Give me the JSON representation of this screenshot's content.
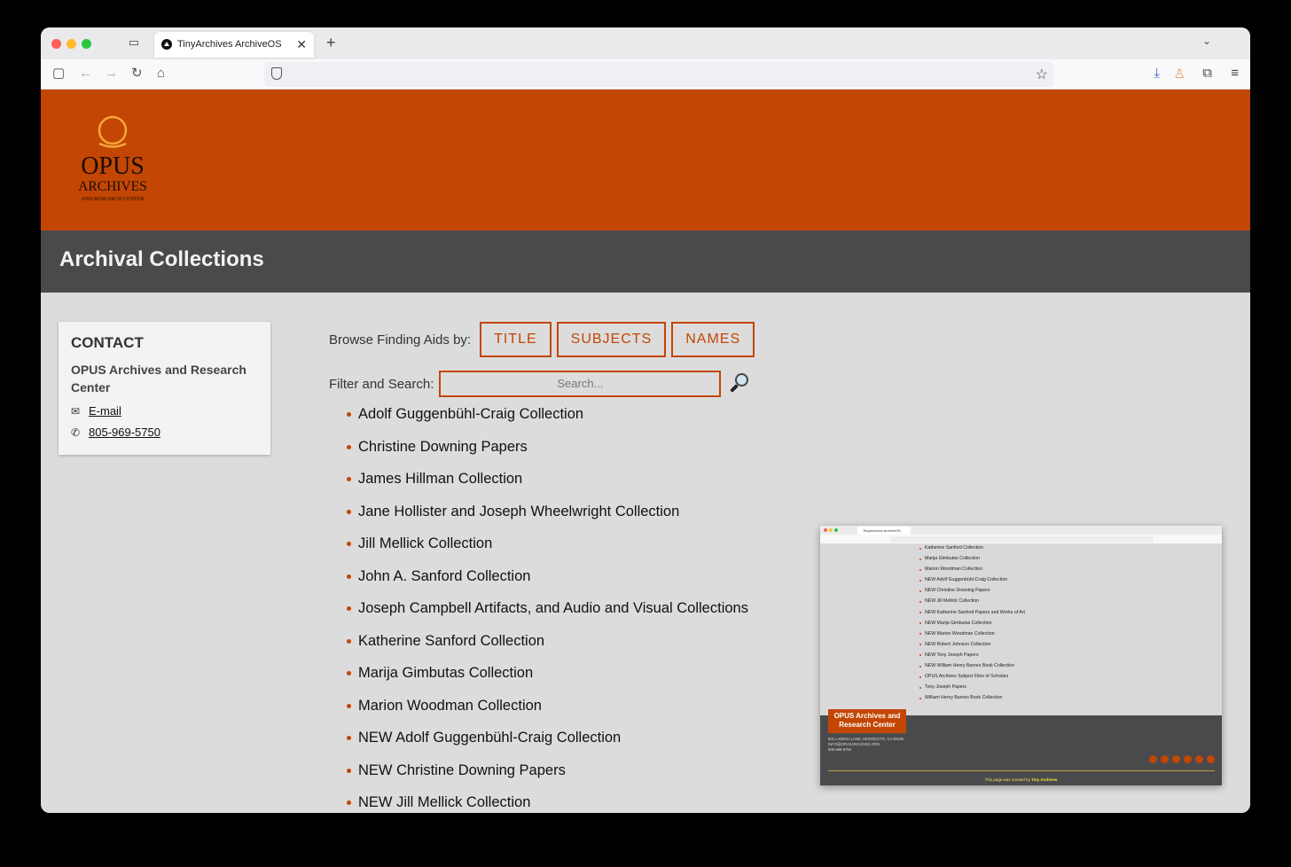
{
  "browser": {
    "tab_title": "TinyArchives ArchiveOS",
    "tab_close": "✕",
    "new_tab": "+",
    "tab_list": "⌄",
    "url": ""
  },
  "site": {
    "logo": {
      "line1": "OPUS",
      "line2": "ARCHIVES",
      "line3": "AND RESEARCH CENTER"
    },
    "page_title": "Archival Collections"
  },
  "contact": {
    "heading": "CONTACT",
    "org": "OPUS Archives and Research Center",
    "email_label": "E-mail",
    "phone": "805-969-5750"
  },
  "browse": {
    "label": "Browse Finding Aids by:",
    "buttons": [
      "TITLE",
      "SUBJECTS",
      "NAMES"
    ]
  },
  "filter": {
    "label": "Filter and Search:",
    "placeholder": "Search..."
  },
  "collections": [
    "Adolf Guggenbühl-Craig Collection",
    "Christine Downing Papers",
    "James Hillman Collection",
    "Jane Hollister and Joseph Wheelwright Collection",
    "Jill Mellick Collection",
    "John A. Sanford Collection",
    "Joseph Campbell Artifacts, and Audio and Visual Collections",
    "Katherine Sanford Collection",
    "Marija Gimbutas Collection",
    "Marion Woodman Collection",
    "NEW Adolf Guggenbühl-Craig Collection",
    "NEW Christine Downing Papers",
    "NEW Jill Mellick Collection"
  ],
  "inset": {
    "tab_title": "TinyArchives ArchiveOS",
    "list": [
      "Katherine Sanford Collection",
      "Marija Gimbutas Collection",
      "Marion Woodman Collection",
      "NEW Adolf Guggenbühl-Craig Collection",
      "NEW Christine Downing Papers",
      "NEW Jill Mellick Collection",
      "NEW Katherine Sanford Papers and Works of Art",
      "NEW Marija Gimbutas Collection",
      "NEW Marion Woodman Collection",
      "NEW Robert Johnson Collection",
      "NEW Tony Joseph Papers",
      "NEW William Henry Barnes Book Collection",
      "OPUS Archives Subject Files of Scholars",
      "Tony Joseph Papers",
      "William Henry Barnes Book Collection"
    ],
    "footer_badge": "OPUS Archives and Research Center",
    "address": "801 LADERA LANE, MONTECITO, CA 93108",
    "email": "INFO@OPUSARCHIVES.ORG",
    "phone": "805-969-5750",
    "credit_prefix": "This page was created by",
    "credit_brand": "Tiny Archives"
  },
  "colors": {
    "accent": "#c34604",
    "band": "#4a4a4c",
    "page_bg": "#dcdcdc"
  }
}
